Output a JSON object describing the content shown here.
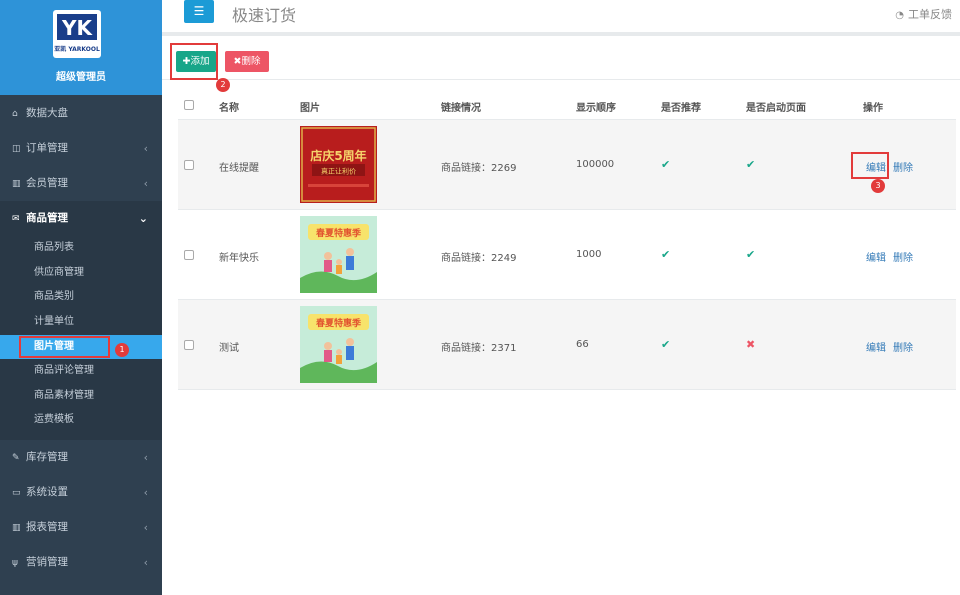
{
  "app": {
    "brand_title": "极速订货",
    "logo_mark": "YK",
    "logo_sub": "亚凯 YARKOOL",
    "admin_name": "超级管理员",
    "feedback": "工单反馈"
  },
  "sidebar": {
    "menu": [
      {
        "label": "数据大盘",
        "icon": "home-icon"
      },
      {
        "label": "订单管理",
        "icon": "columns-icon"
      },
      {
        "label": "会员管理",
        "icon": "bar-chart-icon"
      },
      {
        "label": "商品管理",
        "icon": "envelope-icon"
      },
      {
        "label": "库存管理",
        "icon": "edit-icon"
      },
      {
        "label": "系统设置",
        "icon": "desktop-icon"
      },
      {
        "label": "报表管理",
        "icon": "bar-chart-icon"
      },
      {
        "label": "营销管理",
        "icon": "cutlery-icon"
      }
    ],
    "submenu": [
      {
        "label": "商品列表"
      },
      {
        "label": "供应商管理"
      },
      {
        "label": "商品类别"
      },
      {
        "label": "计量单位"
      },
      {
        "label": "图片管理"
      },
      {
        "label": "商品评论管理"
      },
      {
        "label": "商品素材管理"
      },
      {
        "label": "运费模板"
      }
    ],
    "active_submenu": "图片管理"
  },
  "toolbar": {
    "add_label": "✚添加",
    "delete_label": "✖删除"
  },
  "table": {
    "columns": [
      "名称",
      "图片",
      "链接情况",
      "显示顺序",
      "是否推荐",
      "是否启动页面",
      "操作"
    ],
    "rows": [
      {
        "name": "在线提醒",
        "link": "商品链接：2269",
        "order": "100000",
        "recommend": true,
        "launch_page": true,
        "image": "店庆5周年 真正让利价",
        "edit": "编辑",
        "delete": "删除"
      },
      {
        "name": "新年快乐",
        "link": "商品链接：2249",
        "order": "1000",
        "recommend": true,
        "launch_page": true,
        "image": "春夏特惠季",
        "edit": "编辑",
        "delete": "删除"
      },
      {
        "name": "测试",
        "link": "商品链接：2371",
        "order": "66",
        "recommend": true,
        "launch_page": false,
        "image": "春夏特惠季",
        "edit": "编辑",
        "delete": "删除"
      }
    ]
  },
  "annotations": [
    "1",
    "2",
    "3"
  ],
  "colors": {
    "sidebar_bg": "#2f4050",
    "header_blue": "#2e93d8",
    "active_item": "#37a8ec",
    "add_green": "#18a689",
    "delete_red": "#ed5565",
    "link_blue": "#337ab7",
    "annotation_red": "#e23b3b"
  }
}
